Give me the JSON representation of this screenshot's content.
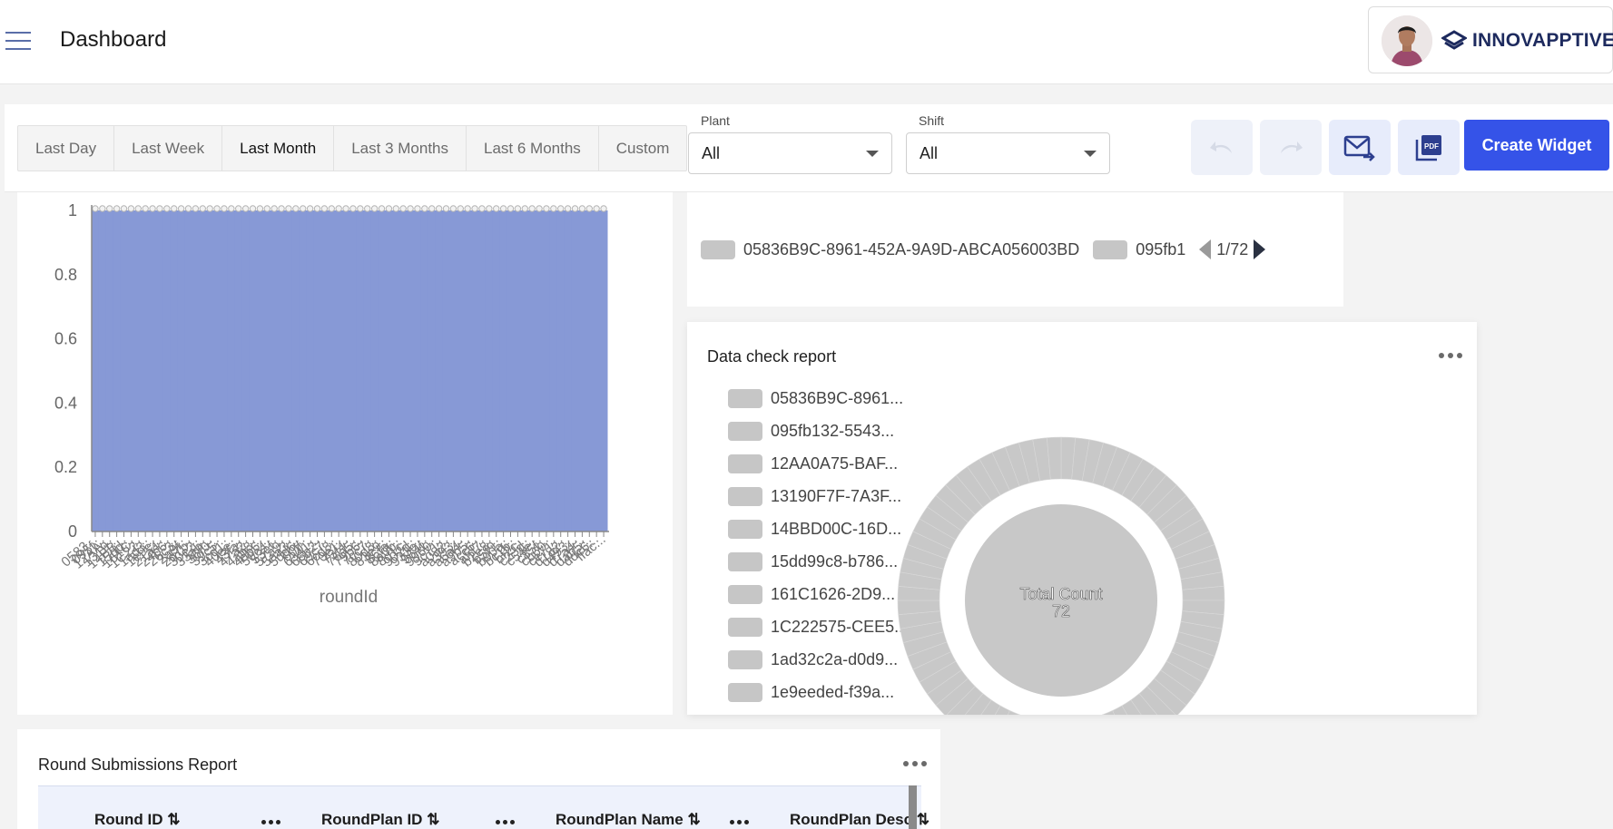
{
  "header": {
    "title": "Dashboard",
    "brand": "INNOVAPPTIVE"
  },
  "toolbar": {
    "ranges": [
      "Last Day",
      "Last Week",
      "Last Month",
      "Last 3 Months",
      "Last 6 Months",
      "Custom"
    ],
    "active_range": "Last Month",
    "plant": {
      "label": "Plant",
      "value": "All"
    },
    "shift": {
      "label": "Shift",
      "value": "All"
    },
    "create_widget": "Create Widget",
    "pdf_badge": "PDF"
  },
  "chart_data": [
    {
      "type": "bar",
      "title": "",
      "xlabel": "roundId",
      "ylabel": "",
      "ylim": [
        0,
        1
      ],
      "yticks": [
        "0",
        "0.2",
        "0.4",
        "0.6",
        "0.8",
        "1"
      ],
      "categories": [
        "0583...",
        "095f...",
        "12AA...",
        "1319...",
        "14BB...",
        "15dd...",
        "161C...",
        "1C22...",
        "1ad3...",
        "1e9e...",
        "21a4...",
        "24b6...",
        "26c3...",
        "2a9f...",
        "2d7b...",
        "30e2...",
        "33ab...",
        "36f0...",
        "39c5...",
        "3cd1...",
        "40ee...",
        "43fa...",
        "47a2...",
        "4ab8...",
        "4db6...",
        "50c4...",
        "53ef...",
        "57a9...",
        "5aa3...",
        "5dd6...",
        "60ff...",
        "6341...",
        "66b2...",
        "69c7...",
        "6cd8...",
        "70e1...",
        "73f4...",
        "76a5...",
        "79b6...",
        "7cc7...",
        "80d8...",
        "83e9...",
        "86fa...",
        "8a0b...",
        "8d1c...",
        "902d...",
        "933e...",
        "964f...",
        "9960...",
        "9c71...",
        "a082...",
        "a393...",
        "a6a4...",
        "a9b5...",
        "acc6...",
        "afd7...",
        "b2e8...",
        "b5f9...",
        "b90a...",
        "bc1b...",
        "bf2c...",
        "c23d...",
        "c54e...",
        "c85f...",
        "cb60...",
        "ce71...",
        "d182...",
        "d493...",
        "d7a4...",
        "dab5...",
        "ddc6...",
        "ffac..."
      ],
      "values": [
        1,
        1,
        1,
        1,
        1,
        1,
        1,
        1,
        1,
        1,
        1,
        1,
        1,
        1,
        1,
        1,
        1,
        1,
        1,
        1,
        1,
        1,
        1,
        1,
        1,
        1,
        1,
        1,
        1,
        1,
        1,
        1,
        1,
        1,
        1,
        1,
        1,
        1,
        1,
        1,
        1,
        1,
        1,
        1,
        1,
        1,
        1,
        1,
        1,
        1,
        1,
        1,
        1,
        1,
        1,
        1,
        1,
        1,
        1,
        1,
        1,
        1,
        1,
        1,
        1,
        1,
        1,
        1,
        1,
        1,
        1,
        1
      ],
      "bar_color": "#8799d6"
    },
    {
      "type": "pie",
      "title": "Data check report",
      "center_label": "Total Count",
      "total": 72,
      "slice_count": 72,
      "slice_color": "#c8c8c8",
      "legend": [
        "05836B9C-8961...",
        "095fb132-5543...",
        "12AA0A75-BAF...",
        "13190F7F-7A3F...",
        "14BBD00C-16D...",
        "15dd99c8-b786...",
        "161C1626-2D9...",
        "1C222575-CEE5...",
        "1ad32c2a-d0d9...",
        "1e9eeded-f39a..."
      ]
    }
  ],
  "legend_widget": {
    "item1": "05836B9C-8961-452A-9A9D-ABCA056003BD",
    "item2": "095fb1",
    "pager": "1/72"
  },
  "round_report": {
    "title": "Round Submissions Report",
    "columns": [
      "Round ID ⇅",
      "RoundPlan ID ⇅",
      "RoundPlan Name ⇅",
      "RoundPlan Desc ⇅"
    ]
  }
}
